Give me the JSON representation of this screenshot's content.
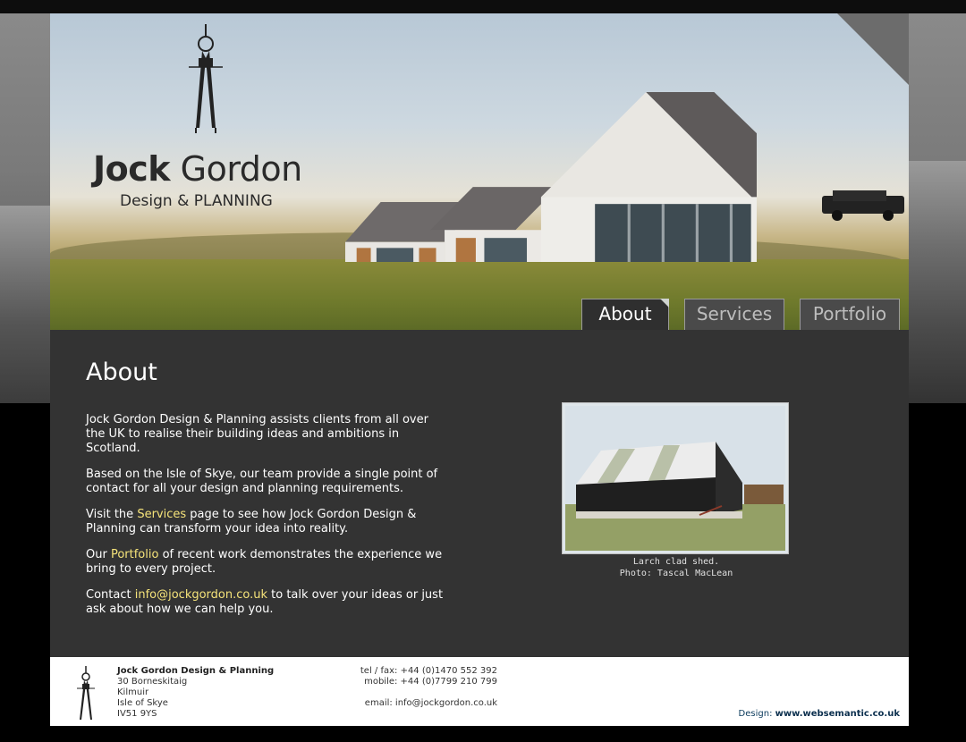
{
  "brand": {
    "name_bold": "Jock",
    "name_rest": " Gordon",
    "subtitle": "Design & PLANNING"
  },
  "nav": {
    "tabs": [
      {
        "label": "About",
        "active": true
      },
      {
        "label": "Services",
        "active": false
      },
      {
        "label": "Portfolio",
        "active": false
      }
    ]
  },
  "main": {
    "heading": "About",
    "paragraphs": {
      "p1": "Jock Gordon Design & Planning assists clients from all over the UK to realise their building ideas and ambitions in Scotland.",
      "p2": "Based on the Isle of Skye, our team provide a single point of contact for all your design and planning requirements.",
      "p3_before": "Visit the ",
      "p3_link": "Services",
      "p3_after": " page to see how Jock Gordon Design & Planning can transform your idea into reality.",
      "p4_before": "Our ",
      "p4_link": "Portfolio",
      "p4_after": " of recent work demonstrates the experience we bring to every project.",
      "p5_before": "Contact ",
      "p5_link": "info@jockgordon.co.uk",
      "p5_after": " to talk over your ideas or just ask about how we can help you."
    },
    "photo": {
      "caption_line1": "Larch clad shed.",
      "caption_line2": "Photo: Tascal MacLean"
    }
  },
  "footer": {
    "company": "Jock Gordon Design & Planning",
    "address": [
      "30 Borneskitaig",
      "Kilmuir",
      "Isle of Skye",
      "IV51 9YS"
    ],
    "tel": "tel / fax: +44 (0)1470 552 392",
    "mobile": "mobile: +44 (0)7799 210 799",
    "email": "email: info@jockgordon.co.uk",
    "credit_label": "Design: ",
    "credit_link": "www.websemantic.co.uk"
  },
  "colors": {
    "content_bg": "#333333",
    "link": "#f5e37a",
    "tab_active_bg": "#2f2f2f",
    "tab_inactive_bg": "#4a4a4a"
  },
  "icons": [
    "drafting-compass-icon"
  ]
}
